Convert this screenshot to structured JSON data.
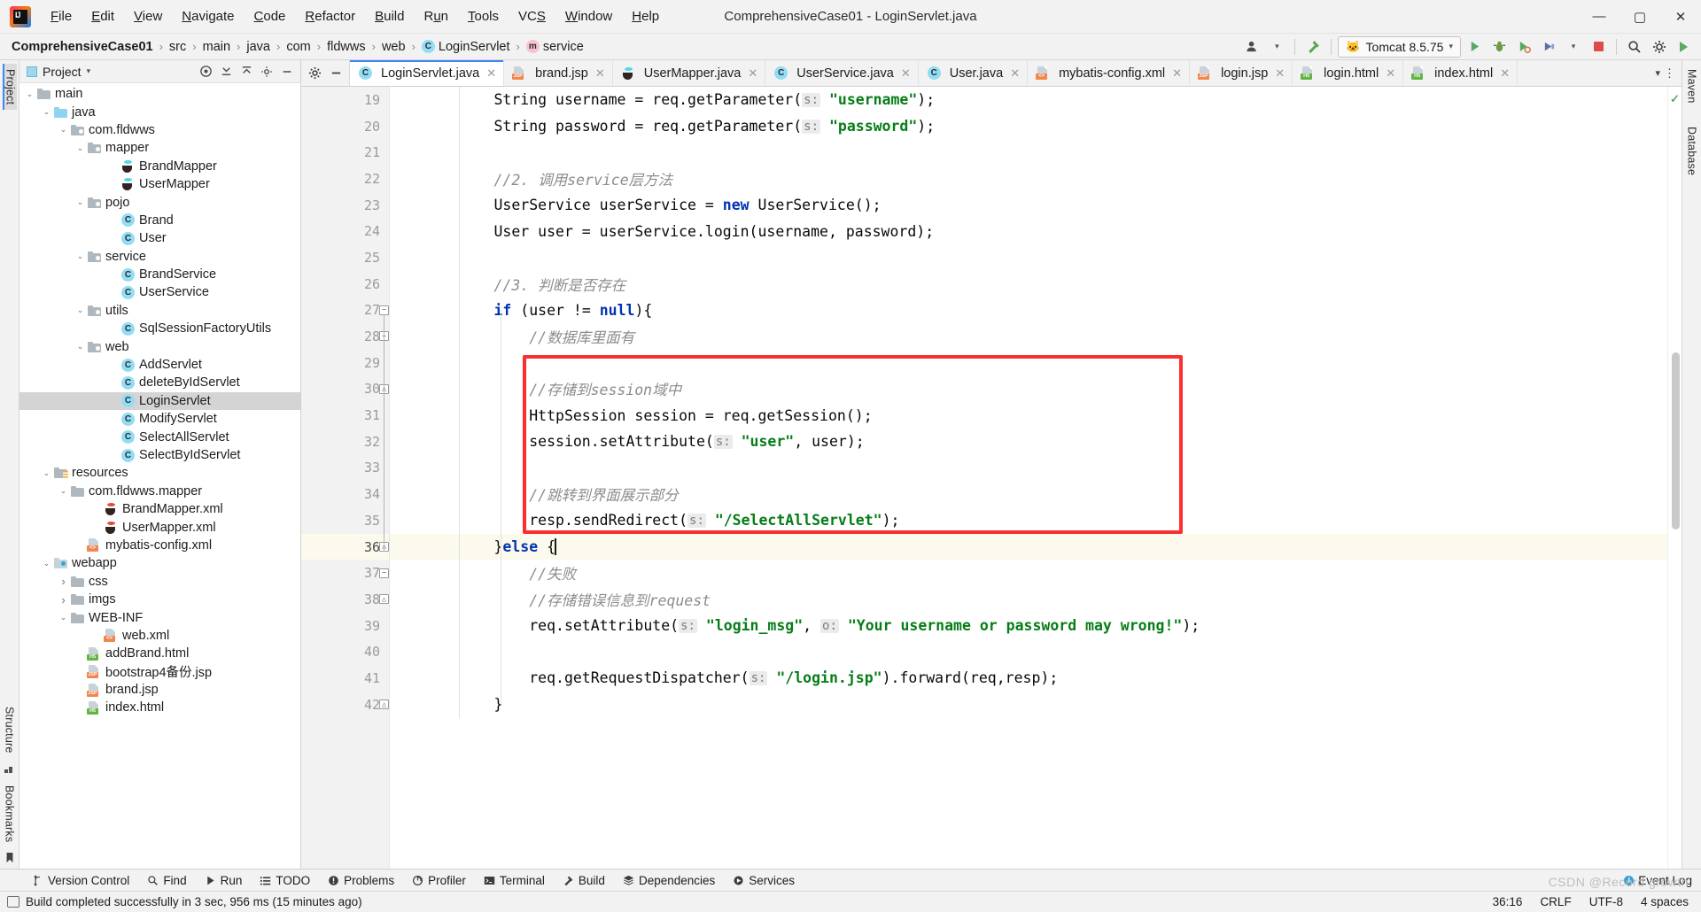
{
  "window": {
    "title": "ComprehensiveCase01 - LoginServlet.java",
    "minimize": "—",
    "maximize": "▢",
    "close": "✕"
  },
  "menu": [
    "File",
    "Edit",
    "View",
    "Navigate",
    "Code",
    "Refactor",
    "Build",
    "Run",
    "Tools",
    "VCS",
    "Window",
    "Help"
  ],
  "breadcrumb": [
    {
      "label": "ComprehensiveCase01",
      "icon": "",
      "bold": true
    },
    {
      "label": "src",
      "icon": ""
    },
    {
      "label": "main",
      "icon": ""
    },
    {
      "label": "java",
      "icon": ""
    },
    {
      "label": "com",
      "icon": ""
    },
    {
      "label": "fldwws",
      "icon": ""
    },
    {
      "label": "web",
      "icon": ""
    },
    {
      "label": "LoginServlet",
      "icon": "C"
    },
    {
      "label": "service",
      "icon": "m"
    }
  ],
  "toolbar": {
    "run_config": "Tomcat 8.5.75",
    "run_icon": "tomcat-cat-icon",
    "search_icon": "magnifier-icon",
    "settings_icon": "gear-icon",
    "user_icon": "user-icon",
    "hammer_icon": "hammer-icon",
    "run_button": "run-icon",
    "debug_button": "debug-icon",
    "coverage_button": "coverage-icon",
    "profiler_button": "profiler-icon",
    "stop_button": "stop-icon",
    "updates_icon": "updates-icon"
  },
  "left_strip": [
    "Project",
    "Structure",
    "Bookmarks"
  ],
  "right_strip": [
    "Maven",
    "Database"
  ],
  "project_panel": {
    "title": "Project",
    "actions": [
      "target-icon",
      "collapse-all-icon",
      "expand-all-icon",
      "settings-icon",
      "hide-icon"
    ],
    "tree": [
      {
        "label": "main",
        "depth": 2,
        "arrow": "v",
        "icon": "folder"
      },
      {
        "label": "java",
        "depth": 3,
        "arrow": "v",
        "icon": "folder-blue"
      },
      {
        "label": "com.fldwws",
        "depth": 4,
        "arrow": "v",
        "icon": "folder-src"
      },
      {
        "label": "mapper",
        "depth": 5,
        "arrow": "v",
        "icon": "folder-src"
      },
      {
        "label": "BrandMapper",
        "depth": 7,
        "arrow": "",
        "icon": "interface-coffee"
      },
      {
        "label": "UserMapper",
        "depth": 7,
        "arrow": "",
        "icon": "interface-coffee"
      },
      {
        "label": "pojo",
        "depth": 5,
        "arrow": "v",
        "icon": "folder-src"
      },
      {
        "label": "Brand",
        "depth": 7,
        "arrow": "",
        "icon": "class"
      },
      {
        "label": "User",
        "depth": 7,
        "arrow": "",
        "icon": "class"
      },
      {
        "label": "service",
        "depth": 5,
        "arrow": "v",
        "icon": "folder-src"
      },
      {
        "label": "BrandService",
        "depth": 7,
        "arrow": "",
        "icon": "class"
      },
      {
        "label": "UserService",
        "depth": 7,
        "arrow": "",
        "icon": "class"
      },
      {
        "label": "utils",
        "depth": 5,
        "arrow": "v",
        "icon": "folder-src"
      },
      {
        "label": "SqlSessionFactoryUtils",
        "depth": 7,
        "arrow": "",
        "icon": "class"
      },
      {
        "label": "web",
        "depth": 5,
        "arrow": "v",
        "icon": "folder-src"
      },
      {
        "label": "AddServlet",
        "depth": 7,
        "arrow": "",
        "icon": "class"
      },
      {
        "label": "deleteByIdServlet",
        "depth": 7,
        "arrow": "",
        "icon": "class"
      },
      {
        "label": "LoginServlet",
        "depth": 7,
        "arrow": "",
        "icon": "class",
        "selected": true
      },
      {
        "label": "ModifyServlet",
        "depth": 7,
        "arrow": "",
        "icon": "class"
      },
      {
        "label": "SelectAllServlet",
        "depth": 7,
        "arrow": "",
        "icon": "class"
      },
      {
        "label": "SelectByIdServlet",
        "depth": 7,
        "arrow": "",
        "icon": "class"
      },
      {
        "label": "resources",
        "depth": 3,
        "arrow": "v",
        "icon": "folder-res"
      },
      {
        "label": "com.fldwws.mapper",
        "depth": 4,
        "arrow": "v",
        "icon": "folder"
      },
      {
        "label": "BrandMapper.xml",
        "depth": 6,
        "arrow": "",
        "icon": "mapper-xml"
      },
      {
        "label": "UserMapper.xml",
        "depth": 6,
        "arrow": "",
        "icon": "mapper-xml"
      },
      {
        "label": "mybatis-config.xml",
        "depth": 5,
        "arrow": "",
        "icon": "xml"
      },
      {
        "label": "webapp",
        "depth": 3,
        "arrow": "v",
        "icon": "folder-webapp"
      },
      {
        "label": "css",
        "depth": 4,
        "arrow": ">",
        "icon": "folder"
      },
      {
        "label": "imgs",
        "depth": 4,
        "arrow": ">",
        "icon": "folder"
      },
      {
        "label": "WEB-INF",
        "depth": 4,
        "arrow": "v",
        "icon": "folder"
      },
      {
        "label": "web.xml",
        "depth": 6,
        "arrow": "",
        "icon": "xml"
      },
      {
        "label": "addBrand.html",
        "depth": 5,
        "arrow": "",
        "icon": "html"
      },
      {
        "label": "bootstrap4备份.jsp",
        "depth": 5,
        "arrow": "",
        "icon": "jsp"
      },
      {
        "label": "brand.jsp",
        "depth": 5,
        "arrow": "",
        "icon": "jsp"
      },
      {
        "label": "index.html",
        "depth": 5,
        "arrow": "",
        "icon": "html"
      }
    ]
  },
  "editor_tabs": [
    {
      "label": "LoginServlet.java",
      "icon": "class",
      "active": true
    },
    {
      "label": "brand.jsp",
      "icon": "jsp",
      "active": false
    },
    {
      "label": "UserMapper.java",
      "icon": "interface-coffee",
      "active": false
    },
    {
      "label": "UserService.java",
      "icon": "class",
      "active": false
    },
    {
      "label": "User.java",
      "icon": "class",
      "active": false
    },
    {
      "label": "mybatis-config.xml",
      "icon": "xml",
      "active": false
    },
    {
      "label": "login.jsp",
      "icon": "jsp",
      "active": false
    },
    {
      "label": "login.html",
      "icon": "html",
      "active": false
    },
    {
      "label": "index.html",
      "icon": "html",
      "active": false
    }
  ],
  "code": {
    "first_line_number": 19,
    "current_line": 36,
    "lines": [
      {
        "n": 19,
        "tokens": [
          {
            "t": "        String username = req.getParameter(",
            "c": ""
          },
          {
            "t": "s:",
            "c": "hint"
          },
          {
            "t": " ",
            "c": ""
          },
          {
            "t": "\"username\"",
            "c": "str"
          },
          {
            "t": ");",
            "c": ""
          }
        ]
      },
      {
        "n": 20,
        "tokens": [
          {
            "t": "        String password = req.getParameter(",
            "c": ""
          },
          {
            "t": "s:",
            "c": "hint"
          },
          {
            "t": " ",
            "c": ""
          },
          {
            "t": "\"password\"",
            "c": "str"
          },
          {
            "t": ");",
            "c": ""
          }
        ]
      },
      {
        "n": 21,
        "tokens": []
      },
      {
        "n": 22,
        "tokens": [
          {
            "t": "        //2. 调用service层方法",
            "c": "cmt"
          }
        ]
      },
      {
        "n": 23,
        "tokens": [
          {
            "t": "        UserService userService = ",
            "c": ""
          },
          {
            "t": "new",
            "c": "kw"
          },
          {
            "t": " UserService();",
            "c": ""
          }
        ]
      },
      {
        "n": 24,
        "tokens": [
          {
            "t": "        User user = userService.login(username, password);",
            "c": ""
          }
        ]
      },
      {
        "n": 25,
        "tokens": []
      },
      {
        "n": 26,
        "tokens": [
          {
            "t": "        //3. 判断是否存在",
            "c": "cmt"
          }
        ]
      },
      {
        "n": 27,
        "tokens": [
          {
            "t": "        ",
            "c": ""
          },
          {
            "t": "if",
            "c": "kw"
          },
          {
            "t": " (user != ",
            "c": ""
          },
          {
            "t": "null",
            "c": "kw"
          },
          {
            "t": "){",
            "c": ""
          }
        ]
      },
      {
        "n": 28,
        "tokens": [
          {
            "t": "            //数据库里面有",
            "c": "cmt"
          }
        ]
      },
      {
        "n": 29,
        "tokens": []
      },
      {
        "n": 30,
        "tokens": [
          {
            "t": "            //存储到session域中",
            "c": "cmt"
          }
        ]
      },
      {
        "n": 31,
        "tokens": [
          {
            "t": "            HttpSession session = req.getSession();",
            "c": ""
          }
        ]
      },
      {
        "n": 32,
        "tokens": [
          {
            "t": "            session.setAttribute(",
            "c": ""
          },
          {
            "t": "s:",
            "c": "hint"
          },
          {
            "t": " ",
            "c": ""
          },
          {
            "t": "\"user\"",
            "c": "str"
          },
          {
            "t": ", user);",
            "c": ""
          }
        ]
      },
      {
        "n": 33,
        "tokens": []
      },
      {
        "n": 34,
        "tokens": [
          {
            "t": "            //跳转到界面展示部分",
            "c": "cmt"
          }
        ]
      },
      {
        "n": 35,
        "tokens": [
          {
            "t": "            resp.sendRedirect(",
            "c": ""
          },
          {
            "t": "s:",
            "c": "hint"
          },
          {
            "t": " ",
            "c": ""
          },
          {
            "t": "\"/SelectAllServlet\"",
            "c": "str"
          },
          {
            "t": ");",
            "c": ""
          }
        ]
      },
      {
        "n": 36,
        "tokens": [
          {
            "t": "        }",
            "c": ""
          },
          {
            "t": "else",
            "c": "kw"
          },
          {
            "t": " {",
            "c": ""
          }
        ],
        "current": true,
        "caret": true
      },
      {
        "n": 37,
        "tokens": [
          {
            "t": "            //失败",
            "c": "cmt"
          }
        ]
      },
      {
        "n": 38,
        "tokens": [
          {
            "t": "            //存储错误信息到request",
            "c": "cmt"
          }
        ]
      },
      {
        "n": 39,
        "tokens": [
          {
            "t": "            req.setAttribute(",
            "c": ""
          },
          {
            "t": "s:",
            "c": "hint"
          },
          {
            "t": " ",
            "c": ""
          },
          {
            "t": "\"login_msg\"",
            "c": "str"
          },
          {
            "t": ", ",
            "c": ""
          },
          {
            "t": "o:",
            "c": "hint"
          },
          {
            "t": " ",
            "c": ""
          },
          {
            "t": "\"Your username or password may wrong!\"",
            "c": "str"
          },
          {
            "t": ");",
            "c": ""
          }
        ]
      },
      {
        "n": 40,
        "tokens": []
      },
      {
        "n": 41,
        "tokens": [
          {
            "t": "            req.getRequestDispatcher(",
            "c": ""
          },
          {
            "t": "s:",
            "c": "hint"
          },
          {
            "t": " ",
            "c": ""
          },
          {
            "t": "\"/login.jsp\"",
            "c": "str"
          },
          {
            "t": ").forward(req,resp);",
            "c": ""
          }
        ]
      },
      {
        "n": 42,
        "tokens": [
          {
            "t": "        }",
            "c": ""
          }
        ]
      }
    ],
    "annotation_box": {
      "label": "red-highlight-box",
      "color": "#fb2f2f"
    },
    "inspection_status": "✓"
  },
  "bottom_toolwindows": [
    {
      "label": "Version Control",
      "icon": "branch-icon"
    },
    {
      "label": "Find",
      "icon": "magnifier-icon"
    },
    {
      "label": "Run",
      "icon": "play-icon"
    },
    {
      "label": "TODO",
      "icon": "list-icon"
    },
    {
      "label": "Problems",
      "icon": "warning-icon"
    },
    {
      "label": "Profiler",
      "icon": "profiler-icon"
    },
    {
      "label": "Terminal",
      "icon": "terminal-icon"
    },
    {
      "label": "Build",
      "icon": "hammer-icon"
    },
    {
      "label": "Dependencies",
      "icon": "layers-icon"
    },
    {
      "label": "Services",
      "icon": "services-icon"
    }
  ],
  "event_log": {
    "label": "Event Log",
    "icon": "info-dot-icon"
  },
  "statusbar": {
    "message": "Build completed successfully in 3 sec, 956 ms (15 minutes ago)",
    "message_icon": "log-icon",
    "caret_position": "36:16",
    "line_separator": "CRLF",
    "encoding": "UTF-8",
    "indent": "4 spaces"
  },
  "watermark": "CSDN @Record growth"
}
